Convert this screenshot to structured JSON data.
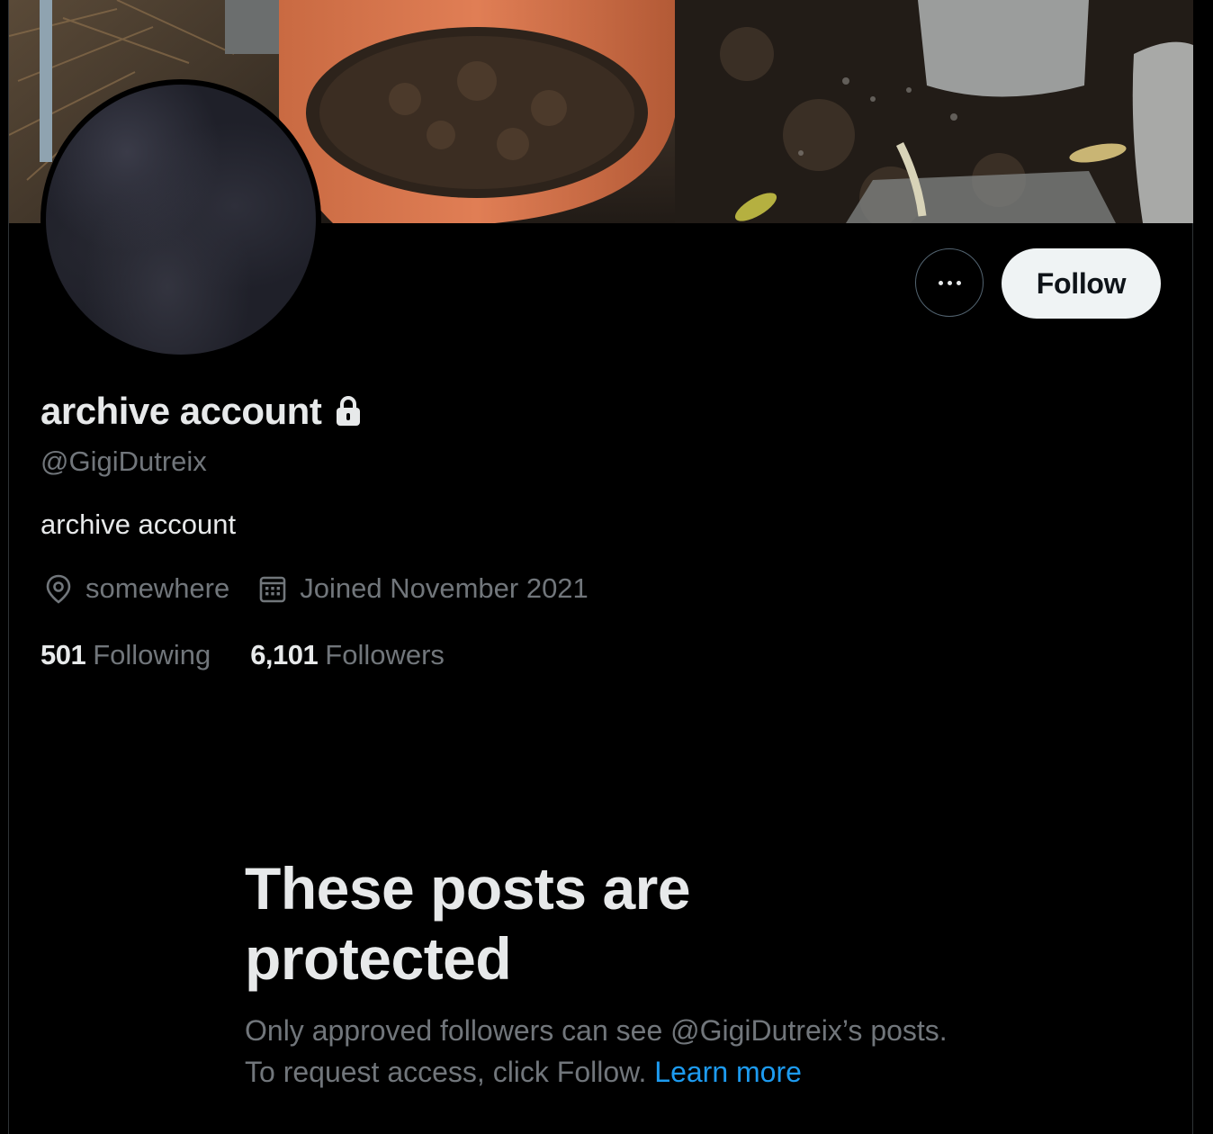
{
  "profile": {
    "display_name": "archive account",
    "handle": "@GigiDutreix",
    "bio": "archive account",
    "location": "somewhere",
    "joined": "Joined November 2021",
    "following_count": "501",
    "following_label": "Following",
    "followers_count": "6,101",
    "followers_label": "Followers"
  },
  "actions": {
    "follow_label": "Follow",
    "more_icon": "more-horizontal-icon"
  },
  "protected_notice": {
    "title": "These posts are protected",
    "body": "Only approved followers can see @GigiDutreix’s posts. To request access, click Follow.",
    "link_label": "Learn more"
  },
  "icons": {
    "lock": "lock-icon",
    "location": "location-pin-icon",
    "calendar": "calendar-icon"
  },
  "colors": {
    "background": "#000000",
    "primary_text": "#e7e9ea",
    "secondary_text": "#71767b",
    "link": "#1d9bf0",
    "follow_button_bg": "#eff3f4"
  }
}
